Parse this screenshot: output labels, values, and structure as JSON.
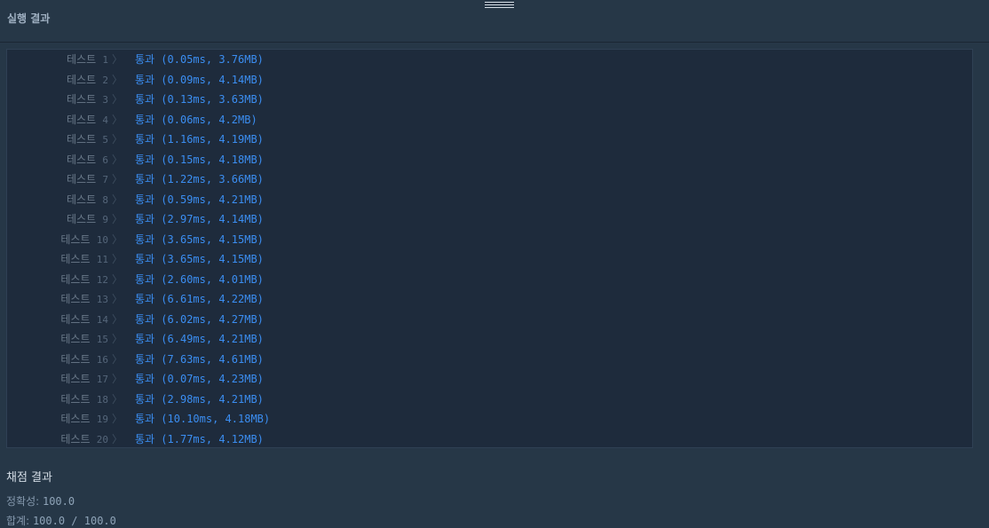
{
  "header": {
    "title": "실행 결과"
  },
  "results": {
    "label_word": "테스트",
    "separator": "〉",
    "rows": [
      {
        "num": "1",
        "text": "통과 (0.05ms, 3.76MB)"
      },
      {
        "num": "2",
        "text": "통과 (0.09ms, 4.14MB)"
      },
      {
        "num": "3",
        "text": "통과 (0.13ms, 3.63MB)"
      },
      {
        "num": "4",
        "text": "통과 (0.06ms, 4.2MB)"
      },
      {
        "num": "5",
        "text": "통과 (1.16ms, 4.19MB)"
      },
      {
        "num": "6",
        "text": "통과 (0.15ms, 4.18MB)"
      },
      {
        "num": "7",
        "text": "통과 (1.22ms, 3.66MB)"
      },
      {
        "num": "8",
        "text": "통과 (0.59ms, 4.21MB)"
      },
      {
        "num": "9",
        "text": "통과 (2.97ms, 4.14MB)"
      },
      {
        "num": "10",
        "text": "통과 (3.65ms, 4.15MB)"
      },
      {
        "num": "11",
        "text": "통과 (3.65ms, 4.15MB)"
      },
      {
        "num": "12",
        "text": "통과 (2.60ms, 4.01MB)"
      },
      {
        "num": "13",
        "text": "통과 (6.61ms, 4.22MB)"
      },
      {
        "num": "14",
        "text": "통과 (6.02ms, 4.27MB)"
      },
      {
        "num": "15",
        "text": "통과 (6.49ms, 4.21MB)"
      },
      {
        "num": "16",
        "text": "통과 (7.63ms, 4.61MB)"
      },
      {
        "num": "17",
        "text": "통과 (0.07ms, 4.23MB)"
      },
      {
        "num": "18",
        "text": "통과 (2.98ms, 4.21MB)"
      },
      {
        "num": "19",
        "text": "통과 (10.10ms, 4.18MB)"
      },
      {
        "num": "20",
        "text": "통과 (1.77ms, 4.12MB)"
      }
    ]
  },
  "score": {
    "title": "채점 결과",
    "accuracy_label": "정확성",
    "accuracy_value": "100.0",
    "total_label": "합계",
    "total_value": "100.0 / 100.0"
  },
  "colors": {
    "background": "#263747",
    "panel": "#1e2b3c",
    "pass": "#3b8ef2"
  }
}
